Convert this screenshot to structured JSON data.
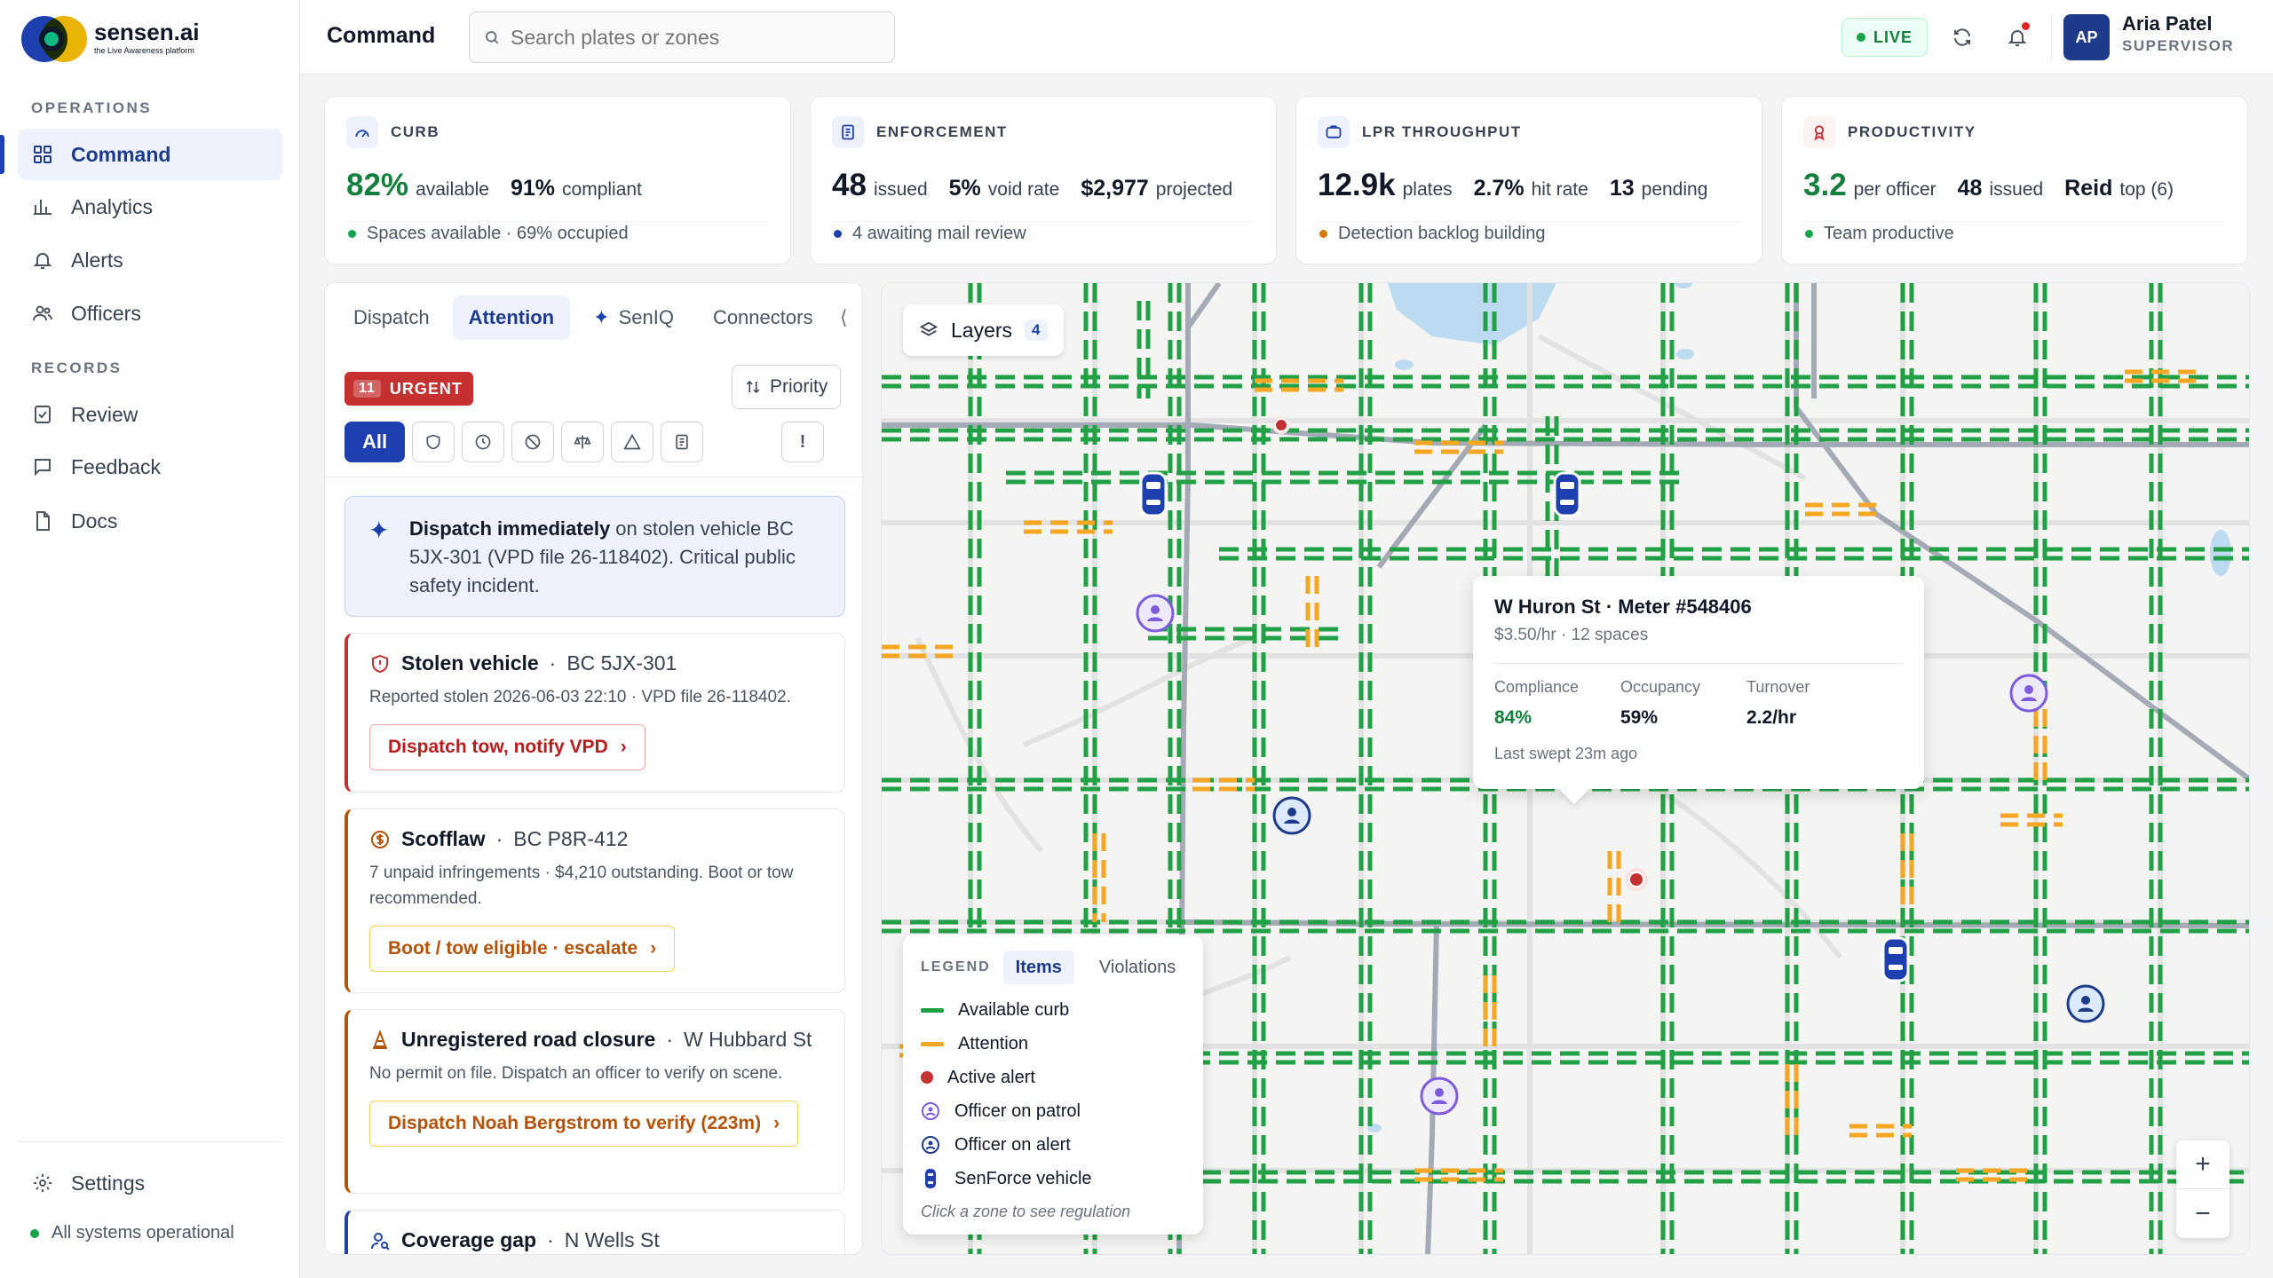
{
  "brand": {
    "name": "sensen.ai",
    "tagline": "the Live Awareness platform"
  },
  "sidebar": {
    "operations_heading": "OPERATIONS",
    "records_heading": "RECORDS",
    "items": [
      {
        "label": "Command",
        "icon": "grid-icon"
      },
      {
        "label": "Analytics",
        "icon": "bar-chart-icon"
      },
      {
        "label": "Alerts",
        "icon": "bell-icon"
      },
      {
        "label": "Officers",
        "icon": "users-icon"
      },
      {
        "label": "Review",
        "icon": "clipboard-check-icon"
      },
      {
        "label": "Feedback",
        "icon": "message-icon"
      },
      {
        "label": "Docs",
        "icon": "file-icon"
      }
    ],
    "settings": "Settings",
    "system_status": "All systems operational"
  },
  "topbar": {
    "title": "Command",
    "search_placeholder": "Search plates or zones",
    "live": "LIVE",
    "user": {
      "initials": "AP",
      "name": "Aria Patel",
      "role": "SUPERVISOR"
    }
  },
  "cards": [
    {
      "title": "CURB",
      "m1": "82%",
      "m1_label": "available",
      "m2": "91%",
      "m2_label": "compliant",
      "m3": "",
      "m3_label": "",
      "status": "Spaces available · 69% occupied",
      "status_color": "#16a34a",
      "accent": "#1e40af"
    },
    {
      "title": "ENFORCEMENT",
      "m1": "48",
      "m1_label": "issued",
      "m2": "5%",
      "m2_label": "void rate",
      "m3": "$2,977",
      "m3_label": "projected",
      "status": "4 awaiting mail review",
      "status_color": "#1e40af",
      "accent": "#1e40af"
    },
    {
      "title": "LPR THROUGHPUT",
      "m1": "12.9k",
      "m1_label": "plates",
      "m2": "2.7%",
      "m2_label": "hit rate",
      "m3": "13",
      "m3_label": "pending",
      "status": "Detection backlog building",
      "status_color": "#d97706",
      "accent": "#1e40af"
    },
    {
      "title": "PRODUCTIVITY",
      "m1": "3.2",
      "m1_label": "per officer",
      "m2": "48",
      "m2_label": "issued",
      "m3": "Reid",
      "m3_label": "top (6)",
      "status": "Team productive",
      "status_color": "#16a34a",
      "accent": "#c53030"
    }
  ],
  "panel": {
    "tabs": [
      "Dispatch",
      "Attention",
      "SenIQ",
      "Connectors"
    ],
    "urgent_count": "11",
    "urgent_label": "URGENT",
    "priority": "Priority",
    "filter_all": "All",
    "filter_bang": "!",
    "ai": {
      "bold": "Dispatch immediately",
      "text": " on stolen vehicle BC 5JX-301 (VPD file 26-118402). Critical public safety incident."
    },
    "alerts": [
      {
        "title": "Stolen vehicle",
        "sub": "BC 5JX-301",
        "desc": "Reported stolen 2026-06-03 22:10 · VPD file 26-118402.",
        "action": "Dispatch tow, notify VPD",
        "kind": "red"
      },
      {
        "title": "Scofflaw",
        "sub": "BC P8R-412",
        "desc": "7 unpaid infringements · $4,210 outstanding. Boot or tow recommended.",
        "action": "Boot / tow eligible · escalate",
        "kind": "amber"
      },
      {
        "title": "Unregistered road closure",
        "sub": "W Hubbard St",
        "desc": "No permit on file. Dispatch an officer to verify on scene.",
        "action": "Dispatch Noah Bergstrom to verify (223m)",
        "kind": "amber"
      },
      {
        "title": "Coverage gap",
        "sub": "N Wells St",
        "desc": "",
        "action": "",
        "kind": "blue"
      }
    ]
  },
  "map": {
    "layers_label": "Layers",
    "layers_count": "4",
    "popup": {
      "title": "W Huron St · Meter #548406",
      "sub": "$3.50/hr · 12 spaces",
      "stats": [
        {
          "label": "Compliance",
          "value": "84%",
          "color": "#15803d"
        },
        {
          "label": "Occupancy",
          "value": "59%",
          "color": "#111827"
        },
        {
          "label": "Turnover",
          "value": "2.2/hr",
          "color": "#111827"
        }
      ],
      "foot": "Last swept 23m ago"
    },
    "legend": {
      "label": "LEGEND",
      "tabs": [
        "Items",
        "Violations"
      ],
      "rows": [
        "Available curb",
        "Attention",
        "Active alert",
        "Officer on patrol",
        "Officer on alert",
        "SenForce vehicle"
      ],
      "note": "Click a zone to see regulation"
    },
    "zoom_in": "+",
    "zoom_out": "−",
    "colors": {
      "available": "#22a045",
      "attention": "#f5a623",
      "alert": "#c53030",
      "patrol": "#7c5cdc",
      "onalert": "#1e3a8a"
    }
  }
}
